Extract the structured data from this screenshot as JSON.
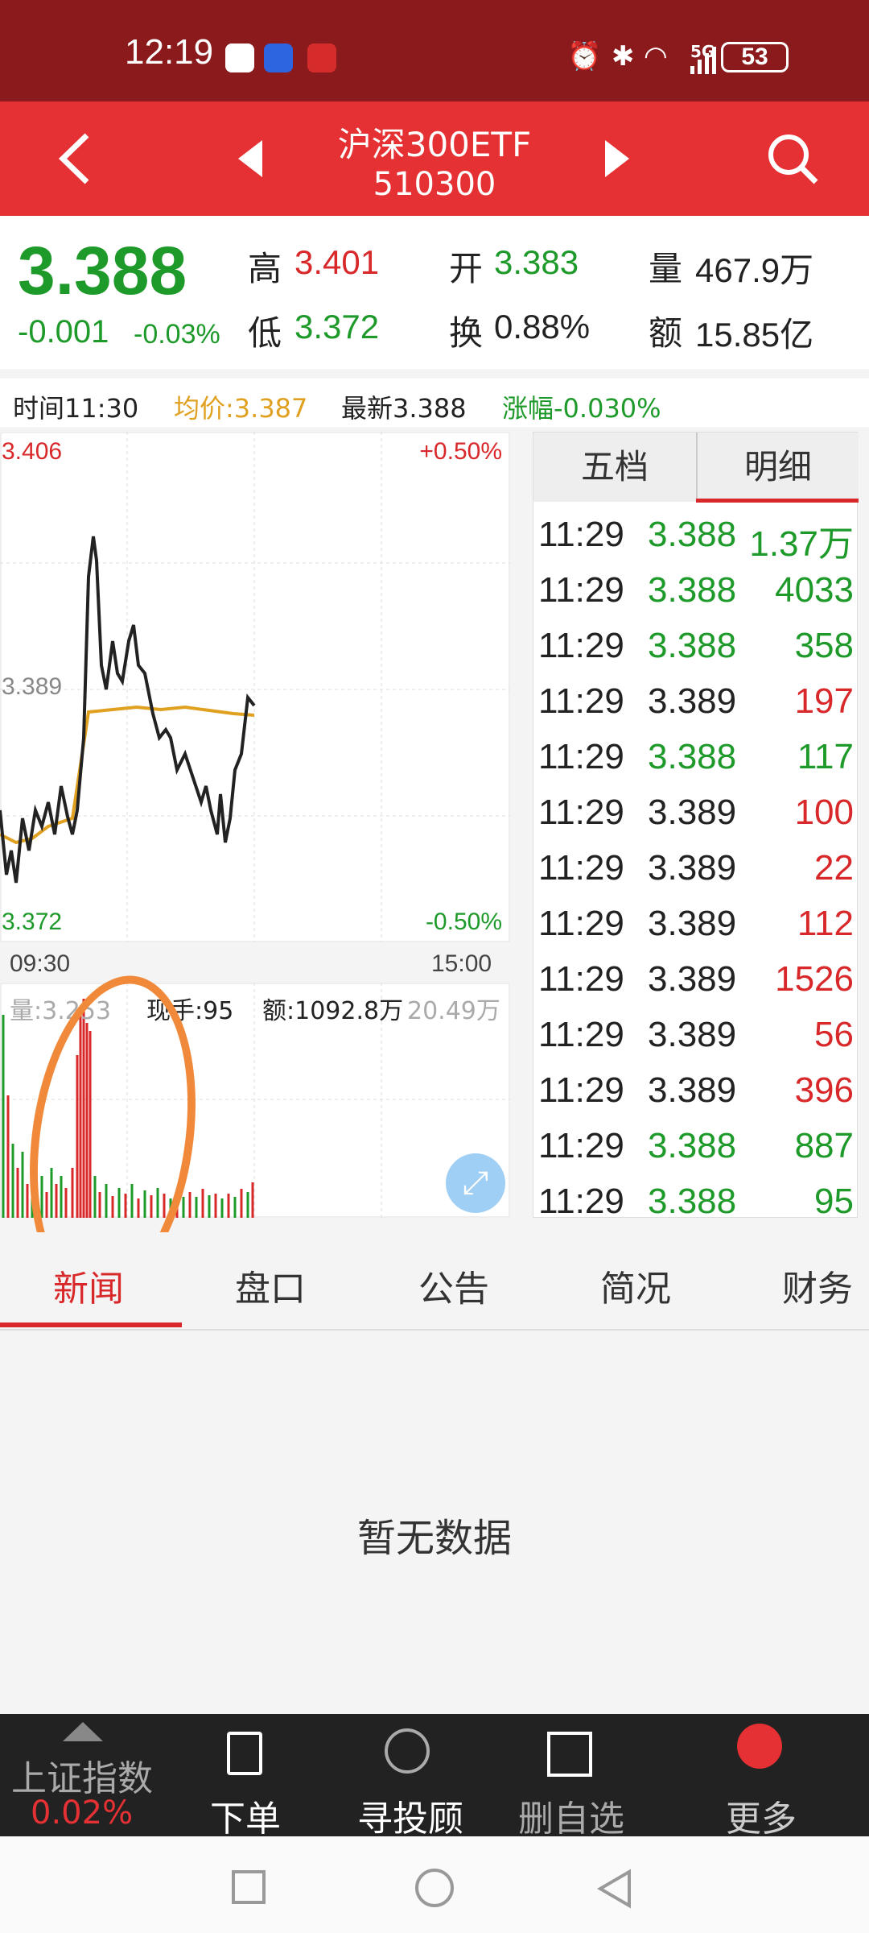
{
  "status_bar": {
    "time": "12:19",
    "battery": "53",
    "network": "5G"
  },
  "header": {
    "title": "沪深300ETF",
    "code": "510300"
  },
  "quote": {
    "price": "3.388",
    "change": "-0.001",
    "change_pct": "-0.03%",
    "items": [
      {
        "label": "高",
        "value": "3.401",
        "color": "#d8282a"
      },
      {
        "label": "开",
        "value": "3.383",
        "color": "#1e9a2a"
      },
      {
        "label": "量",
        "value": "467.9万",
        "color": "#222222"
      },
      {
        "label": "低",
        "value": "3.372",
        "color": "#1e9a2a"
      },
      {
        "label": "换",
        "value": "0.88%",
        "color": "#222222"
      },
      {
        "label": "额",
        "value": "15.85亿",
        "color": "#222222"
      }
    ]
  },
  "info_row": {
    "time": "时间11:30",
    "avg": "均价:3.387",
    "latest": "最新3.388",
    "change": "涨幅-0.030%"
  },
  "chart": {
    "y_max": "3.406",
    "y_mid": "3.389",
    "y_min": "3.372",
    "pct_max": "+0.50%",
    "pct_min": "-0.50%",
    "x_start": "09:30",
    "x_end": "15:00",
    "vol_label": "量:3.253",
    "now_hand": "现手:95",
    "amount": "额:1092.8万",
    "vol_right": "20.49万"
  },
  "tape": {
    "tabs": [
      "五档",
      "明细"
    ],
    "rows": [
      {
        "time": "11:29",
        "price": "3.388",
        "vol": "1.37万",
        "pc": "green",
        "vc": "green"
      },
      {
        "time": "11:29",
        "price": "3.388",
        "vol": "4033",
        "pc": "green",
        "vc": "green"
      },
      {
        "time": "11:29",
        "price": "3.388",
        "vol": "358",
        "pc": "green",
        "vc": "green"
      },
      {
        "time": "11:29",
        "price": "3.389",
        "vol": "197",
        "pc": "dark",
        "vc": "red"
      },
      {
        "time": "11:29",
        "price": "3.388",
        "vol": "117",
        "pc": "green",
        "vc": "green"
      },
      {
        "time": "11:29",
        "price": "3.389",
        "vol": "100",
        "pc": "dark",
        "vc": "red"
      },
      {
        "time": "11:29",
        "price": "3.389",
        "vol": "22",
        "pc": "dark",
        "vc": "red"
      },
      {
        "time": "11:29",
        "price": "3.389",
        "vol": "112",
        "pc": "dark",
        "vc": "red"
      },
      {
        "time": "11:29",
        "price": "3.389",
        "vol": "1526",
        "pc": "dark",
        "vc": "red"
      },
      {
        "time": "11:29",
        "price": "3.389",
        "vol": "56",
        "pc": "dark",
        "vc": "red"
      },
      {
        "time": "11:29",
        "price": "3.389",
        "vol": "396",
        "pc": "dark",
        "vc": "red"
      },
      {
        "time": "11:29",
        "price": "3.388",
        "vol": "887",
        "pc": "green",
        "vc": "green"
      },
      {
        "time": "11:29",
        "price": "3.388",
        "vol": "95",
        "pc": "green",
        "vc": "green"
      }
    ]
  },
  "bottom_tabs": [
    "新闻",
    "盘口",
    "公告",
    "简况",
    "财务"
  ],
  "empty_text": "暂无数据",
  "bottom_nav": {
    "index_name": "上证指数",
    "index_pct": "0.02%",
    "items": [
      "下单",
      "寻投顾",
      "删自选",
      "更多"
    ]
  },
  "colors": {
    "header_red": "#e53133",
    "status_red": "#8b1a1c",
    "up": "#d8282a",
    "down": "#1e9a2a",
    "avg_line": "#e0a020"
  }
}
